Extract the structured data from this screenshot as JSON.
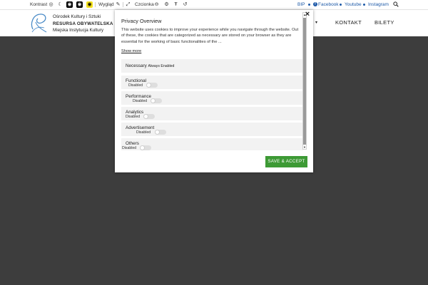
{
  "toolbar": {
    "contrast_label": "Kontrast",
    "appearance_label": "Wygląd",
    "font_label": "Czcionka",
    "icons": [
      "contrast-icon",
      "moon-icon",
      "eye-icon",
      "eye-icon",
      "eye-icon",
      "pen-icon",
      "expand-icon",
      "minus-icon",
      "gear-icon",
      "text-size-icon",
      "reset-icon",
      "search-icon"
    ],
    "links": {
      "bip": "BIP",
      "facebook": "Facebook",
      "youtube": "Youtube",
      "instagram": "Instagram"
    }
  },
  "header": {
    "logo": {
      "line1": "Ośrodek Kultury i Sztuki",
      "line2": "RESURSA OBYWATELSKA",
      "line3": "Miejska Instytucja Kultury"
    },
    "nav": {
      "dropdown_arrow": "▾",
      "kontakt": "KONTAKT",
      "bilety": "BILETY"
    }
  },
  "modal": {
    "close_symbol": "×",
    "title": "Privacy Overview",
    "description": "This website uses cookies to improve your experience while you navigate through the website. Out of these, the cookies that are categorized as necessary are stored on your browser as they are essential for the working of basic functionalities of the ...",
    "show_more": "Show more",
    "categories": [
      {
        "name": "Necessary",
        "status": "Always Enabled"
      },
      {
        "name": "Functional",
        "status": "Disabled"
      },
      {
        "name": "Performance",
        "status": "Disabled"
      },
      {
        "name": "Analytics",
        "status": "Disabled"
      },
      {
        "name": "Advertisement",
        "status": "Disabled"
      },
      {
        "name": "Others",
        "status": "Disabled"
      }
    ],
    "save_button": "SAVE & ACCEPT"
  },
  "colors": {
    "accent_green": "#3d9a35",
    "link_blue": "#1e5aa8",
    "overlay": "#3d3d3d",
    "highlight_yellow": "#f5e21b"
  }
}
